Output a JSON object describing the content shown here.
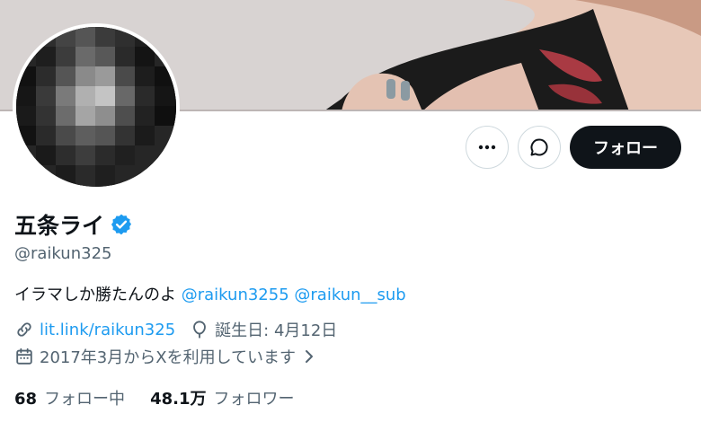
{
  "profile": {
    "display_name": "五条ライ",
    "handle": "@raikun325",
    "bio_text": "イラマしか勝たんのよ",
    "bio_mentions": [
      "@raikun3255",
      "@raikun__sub"
    ],
    "link": "lit.link/raikun325",
    "birthday": "誕生日: 4月12日",
    "joined": "2017年3月からXを利用しています",
    "following_count": "68",
    "following_label": "フォロー中",
    "followers_count": "48.1万",
    "followers_label": "フォロワー"
  },
  "actions": {
    "follow_label": "フォロー"
  },
  "icons": {
    "more": "more-icon",
    "message": "message-icon",
    "verified": "verified-badge-icon",
    "link": "link-icon",
    "birthday": "balloon-icon",
    "calendar": "calendar-icon",
    "chevron": "chevron-right-icon"
  },
  "colors": {
    "accent": "#1d9bf0",
    "text": "#0f1419",
    "muted": "#536471",
    "button_dark": "#0f1419"
  }
}
